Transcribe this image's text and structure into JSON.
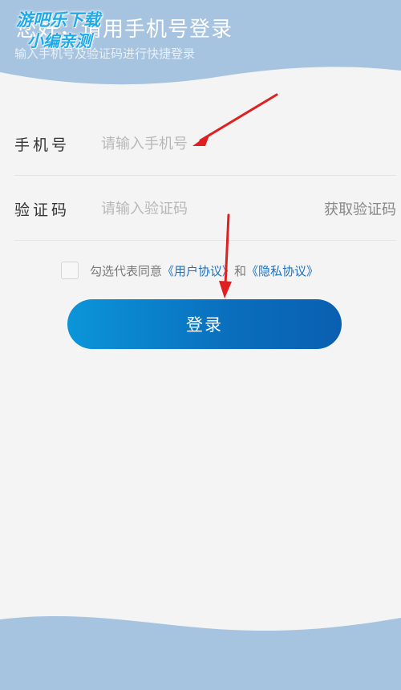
{
  "header": {
    "title": "您好，请用手机号登录",
    "subtitle": "输入手机号及验证码进行快捷登录"
  },
  "watermark": {
    "line1": "游吧乐下载",
    "line2": "小编亲测"
  },
  "form": {
    "phone_label": "手机号",
    "phone_placeholder": "请输入手机号",
    "code_label": "验证码",
    "code_placeholder": "请输入验证码",
    "get_code": "获取验证码"
  },
  "agreement": {
    "prefix": "勾选代表同意",
    "user_agreement": "《用户协议》",
    "and": "和",
    "privacy_agreement": "《隐私协议》"
  },
  "login_button": "登录",
  "colors": {
    "accent": "#0a72c4",
    "annotation_arrow": "#e02020"
  }
}
